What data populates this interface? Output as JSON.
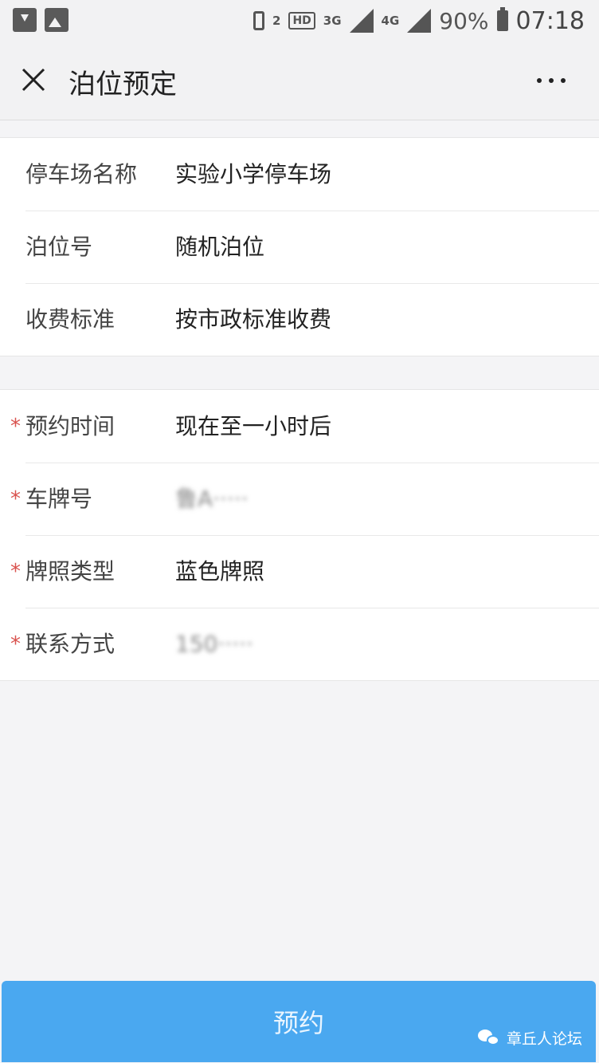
{
  "status_bar": {
    "hd_sub": "2",
    "hd_label": "HD",
    "net_3g": "3G",
    "net_4g": "4G",
    "battery": "90%",
    "time": "07:18"
  },
  "nav": {
    "title": "泊位预定"
  },
  "info": [
    {
      "label": "停车场名称",
      "value": "实验小学停车场"
    },
    {
      "label": "泊位号",
      "value": "随机泊位"
    },
    {
      "label": "收费标准",
      "value": "按市政标准收费"
    }
  ],
  "form": [
    {
      "required_mark": "*",
      "label": "预约时间",
      "value": "现在至一小时后"
    },
    {
      "required_mark": "*",
      "label": "车牌号",
      "value": "鲁A·····"
    },
    {
      "required_mark": "*",
      "label": "牌照类型",
      "value": "蓝色牌照"
    },
    {
      "required_mark": "*",
      "label": "联系方式",
      "value": "150·····"
    }
  ],
  "actions": {
    "reserve_label": "预约"
  },
  "watermark": {
    "text": "章丘人论坛"
  },
  "colors": {
    "accent": "#4aa8f0",
    "required": "#d9534f",
    "background": "#f4f4f6"
  }
}
